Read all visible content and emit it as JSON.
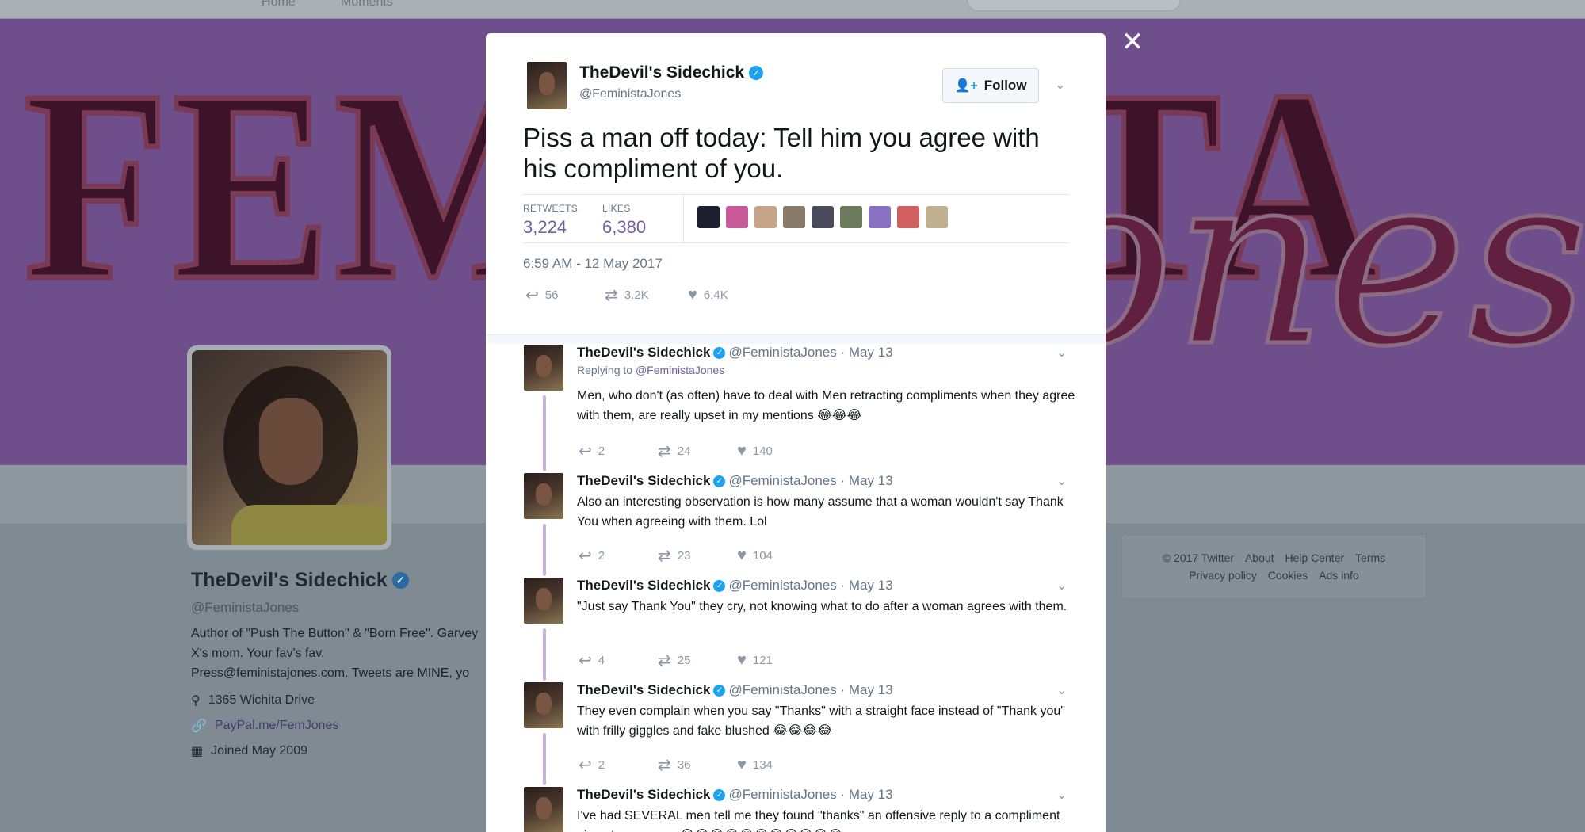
{
  "background": {
    "nav": [
      "Home",
      "Moments"
    ],
    "banner_text_left": "FEMINISTA",
    "banner_text_right": "Jones",
    "profile": {
      "name": "TheDevil's Sidechick",
      "handle": "@FeministaJones",
      "bio": "Author of \"Push The Button\" & \"Born Free\". Garvey X's mom. Your fav's fav. Press@feministajones.com. Tweets are MINE, yo",
      "location": "1365 Wichita Drive",
      "link": "PayPal.me/FemJones",
      "joined": "Joined May 2009"
    },
    "footer": {
      "row1": [
        "© 2017 Twitter",
        "About",
        "Help Center",
        "Terms"
      ],
      "row2": [
        "Privacy policy",
        "Cookies",
        "Ads info"
      ]
    }
  },
  "modal": {
    "close_glyph": "✕",
    "tweet": {
      "name": "TheDevil's Sidechick",
      "handle": "@FeministaJones",
      "follow_label": "Follow",
      "text": "Piss a man off today: Tell him you agree with his compliment of you.",
      "retweets_label": "RETWEETS",
      "retweets": "3,224",
      "likes_label": "LIKES",
      "likes": "6,380",
      "liker_colors": [
        "#1c2030",
        "#c85a9a",
        "#c8a488",
        "#8a7a6a",
        "#4a4a5a",
        "#6a7a5a",
        "#8a70c0",
        "#d06060",
        "#c0b090"
      ],
      "timestamp": "6:59 AM - 12 May 2017",
      "action_counts": {
        "reply": "56",
        "retweet": "3.2K",
        "like": "6.4K"
      }
    },
    "replies": [
      {
        "name": "TheDevil's Sidechick",
        "meta": "@FeministaJones · May 13",
        "replying_prefix": "Replying to",
        "replying_to": "@FeministaJones",
        "text": "Men, who don't (as often) have to deal with Men retracting compliments when they agree with them, are really upset in my mentions 😂😂😂",
        "counts": {
          "reply": "2",
          "retweet": "24",
          "like": "140"
        }
      },
      {
        "name": "TheDevil's Sidechick",
        "meta": "@FeministaJones · May 13",
        "text": "Also an interesting observation is how many assume that a woman wouldn't say Thank You when agreeing with them. Lol",
        "counts": {
          "reply": "2",
          "retweet": "23",
          "like": "104"
        }
      },
      {
        "name": "TheDevil's Sidechick",
        "meta": "@FeministaJones · May 13",
        "text": "\"Just say Thank You\" they cry, not knowing what to do after a woman agrees with them.",
        "counts": {
          "reply": "4",
          "retweet": "25",
          "like": "121"
        }
      },
      {
        "name": "TheDevil's Sidechick",
        "meta": "@FeministaJones · May 13",
        "text": "They even complain when you say \"Thanks\" with a straight face instead of \"Thank you\" with frilly giggles and fake blushed 😂😂😂😂",
        "counts": {
          "reply": "2",
          "retweet": "36",
          "like": "134"
        }
      },
      {
        "name": "TheDevil's Sidechick",
        "meta": "@FeministaJones · May 13",
        "text": "I've had SEVERAL men tell me they found \"thanks\" an offensive reply to a compliment given to a woman 😂😂😂😂😂😂😂😂😂😂😂",
        "counts": {
          "reply": "",
          "retweet": "",
          "like": ""
        }
      }
    ]
  }
}
